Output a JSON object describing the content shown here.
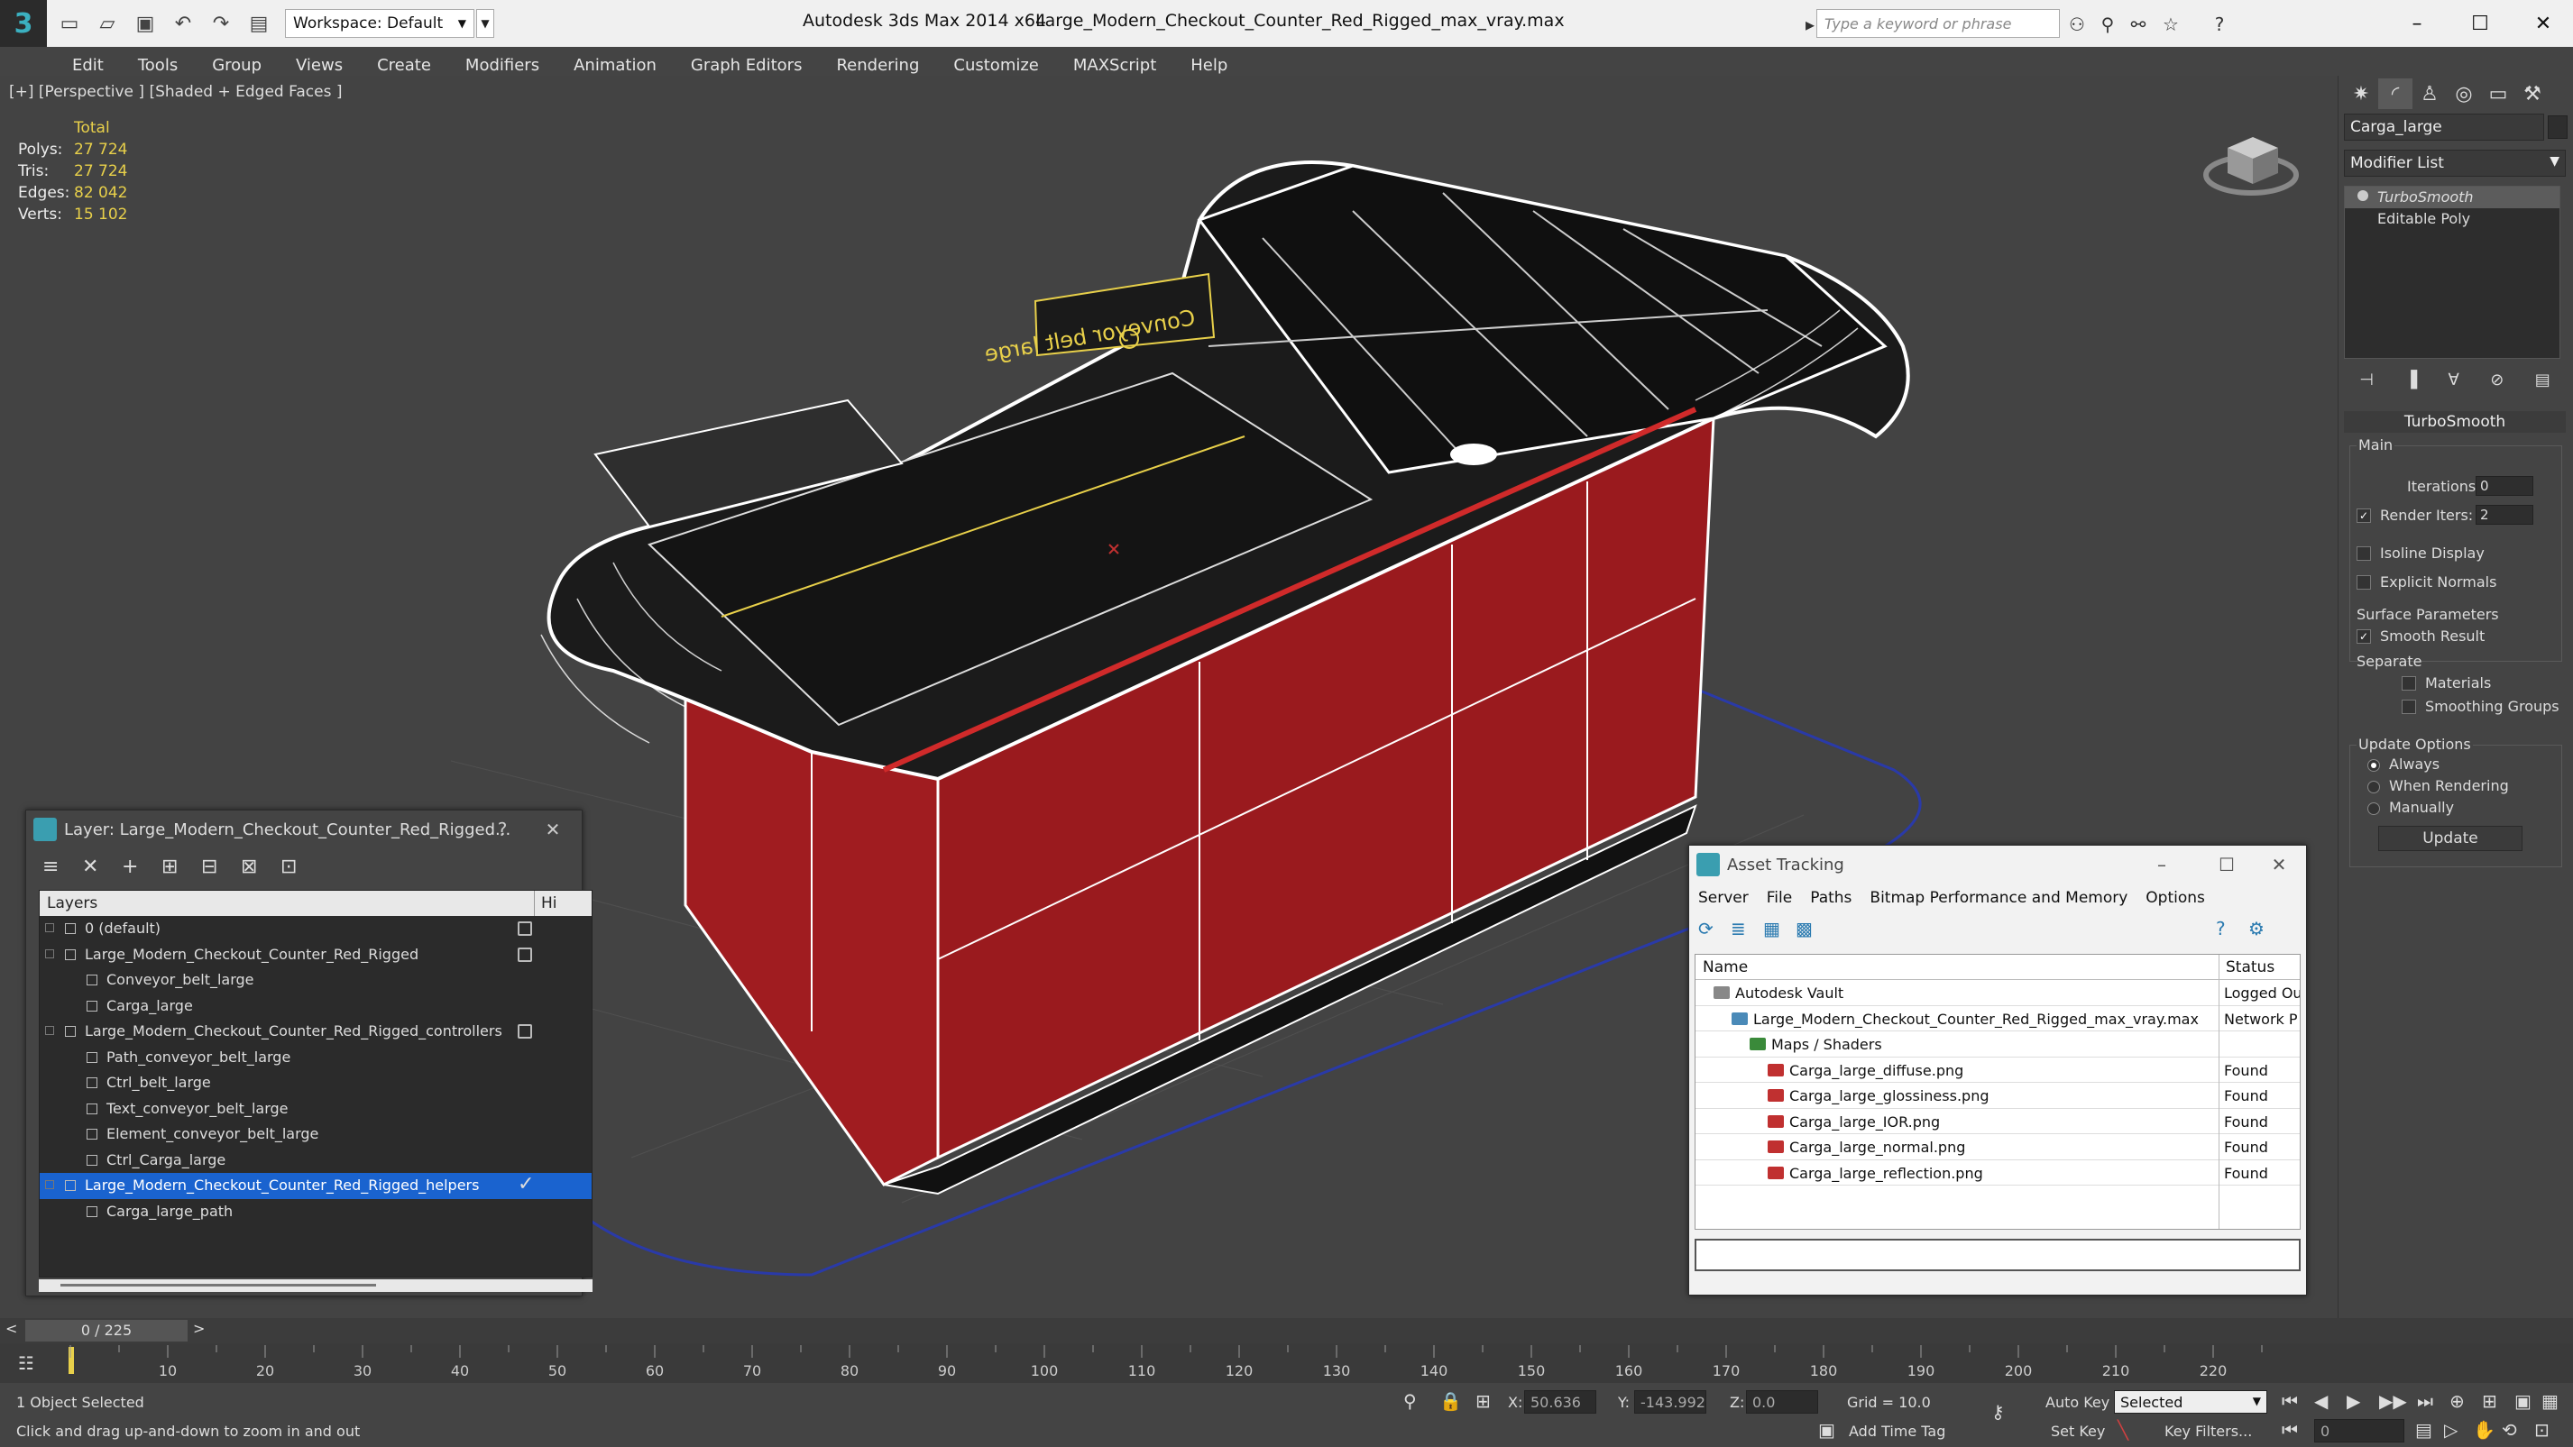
{
  "titlebar": {
    "workspace": "Workspace: Default",
    "app_title": "Autodesk 3ds Max  2014 x64",
    "file_title": "Large_Modern_Checkout_Counter_Red_Rigged_max_vray.max",
    "search_placeholder": "Type a keyword or phrase"
  },
  "menu": [
    "Edit",
    "Tools",
    "Group",
    "Views",
    "Create",
    "Modifiers",
    "Animation",
    "Graph Editors",
    "Rendering",
    "Customize",
    "MAXScript",
    "Help"
  ],
  "viewport": {
    "label": "[+] [Perspective ] [Shaded + Edged Faces ]",
    "stats_header": "Total",
    "stats": [
      {
        "k": "Polys:",
        "v": "27 724"
      },
      {
        "k": "Tris:",
        "v": "27 724"
      },
      {
        "k": "Edges:",
        "v": "82 042"
      },
      {
        "k": "Verts:",
        "v": "15 102"
      }
    ],
    "sign_text": "Conveyor belt large"
  },
  "command_panel": {
    "object_name": "Carga_large",
    "modifier_list": "Modifier List",
    "stack": [
      {
        "label": "TurboSmooth",
        "selected": true
      },
      {
        "label": "Editable Poly",
        "selected": false
      }
    ],
    "rollout_title": "TurboSmooth",
    "main_group": "Main",
    "iterations_label": "Iterations:",
    "iterations_value": "0",
    "render_iters_label": "Render Iters:",
    "render_iters_value": "2",
    "isoline": "Isoline Display",
    "explicit_normals": "Explicit Normals",
    "surface_params": "Surface Parameters",
    "smooth_result": "Smooth Result",
    "separate": "Separate",
    "materials": "Materials",
    "smoothing_groups": "Smoothing Groups",
    "update_options": "Update Options",
    "always": "Always",
    "when_rendering": "When Rendering",
    "manually": "Manually",
    "update": "Update"
  },
  "layer_dialog": {
    "title": "Layer: Large_Modern_Checkout_Counter_Red_Rigged...",
    "help": "?",
    "header_layers": "Layers",
    "header_hi": "Hi",
    "rows": [
      {
        "label": "0 (default)",
        "indent": 0,
        "type": "layer",
        "vis": true
      },
      {
        "label": "Large_Modern_Checkout_Counter_Red_Rigged",
        "indent": 0,
        "type": "layer",
        "vis": true
      },
      {
        "label": "Conveyor_belt_large",
        "indent": 1,
        "type": "object",
        "vis": false
      },
      {
        "label": "Carga_large",
        "indent": 1,
        "type": "object",
        "vis": false
      },
      {
        "label": "Large_Modern_Checkout_Counter_Red_Rigged_controllers",
        "indent": 0,
        "type": "layer",
        "vis": true
      },
      {
        "label": "Path_conveyor_belt_large",
        "indent": 1,
        "type": "object",
        "vis": false
      },
      {
        "label": "Ctrl_belt_large",
        "indent": 1,
        "type": "object",
        "vis": false
      },
      {
        "label": "Text_conveyor_belt_large",
        "indent": 1,
        "type": "object",
        "vis": false
      },
      {
        "label": "Element_conveyor_belt_large",
        "indent": 1,
        "type": "object",
        "vis": false
      },
      {
        "label": "Ctrl_Carga_large",
        "indent": 1,
        "type": "object",
        "vis": false
      },
      {
        "label": "Large_Modern_Checkout_Counter_Red_Rigged_helpers",
        "indent": 0,
        "type": "layer",
        "vis": false,
        "selected": true,
        "check": "✓"
      },
      {
        "label": "Carga_large_path",
        "indent": 1,
        "type": "object",
        "vis": false
      }
    ]
  },
  "asset_dialog": {
    "title": "Asset Tracking",
    "menu": [
      "Server",
      "File",
      "Paths",
      "Bitmap Performance and Memory",
      "Options"
    ],
    "col_name": "Name",
    "col_status": "Status",
    "rows": [
      {
        "name": "Autodesk Vault",
        "status": "Logged Out",
        "indent": 1,
        "icon": "vault"
      },
      {
        "name": "Large_Modern_Checkout_Counter_Red_Rigged_max_vray.max",
        "status": "Network P",
        "indent": 2,
        "icon": "max"
      },
      {
        "name": "Maps / Shaders",
        "status": "",
        "indent": 3,
        "icon": "folder"
      },
      {
        "name": "Carga_large_diffuse.png",
        "status": "Found",
        "indent": 4,
        "icon": "png"
      },
      {
        "name": "Carga_large_glossiness.png",
        "status": "Found",
        "indent": 4,
        "icon": "png"
      },
      {
        "name": "Carga_large_IOR.png",
        "status": "Found",
        "indent": 4,
        "icon": "png"
      },
      {
        "name": "Carga_large_normal.png",
        "status": "Found",
        "indent": 4,
        "icon": "png"
      },
      {
        "name": "Carga_large_reflection.png",
        "status": "Found",
        "indent": 4,
        "icon": "png"
      }
    ]
  },
  "timeline": {
    "frame": "0 / 225",
    "ticks": [
      "10",
      "20",
      "30",
      "40",
      "50",
      "60",
      "70",
      "80",
      "90",
      "100",
      "110",
      "120",
      "130",
      "140",
      "150",
      "160",
      "170",
      "180",
      "190",
      "200",
      "210",
      "220"
    ]
  },
  "status": {
    "selected": "1 Object Selected",
    "hint": "Click and drag up-and-down to zoom in and out",
    "x_label": "X:",
    "x_value": "50.636",
    "y_label": "Y:",
    "y_value": "-143.992",
    "z_label": "Z:",
    "z_value": "0.0",
    "grid": "Grid = 10.0",
    "add_time_tag": "Add Time Tag",
    "auto_key": "Auto Key",
    "set_key": "Set Key",
    "selected_dd": "Selected",
    "key_filters": "Key Filters...",
    "frame_value": "0"
  },
  "colors": {
    "counter_red": "#a01c20",
    "selection_blue": "#1a63cf",
    "stats_yellow": "#e8d04a"
  }
}
